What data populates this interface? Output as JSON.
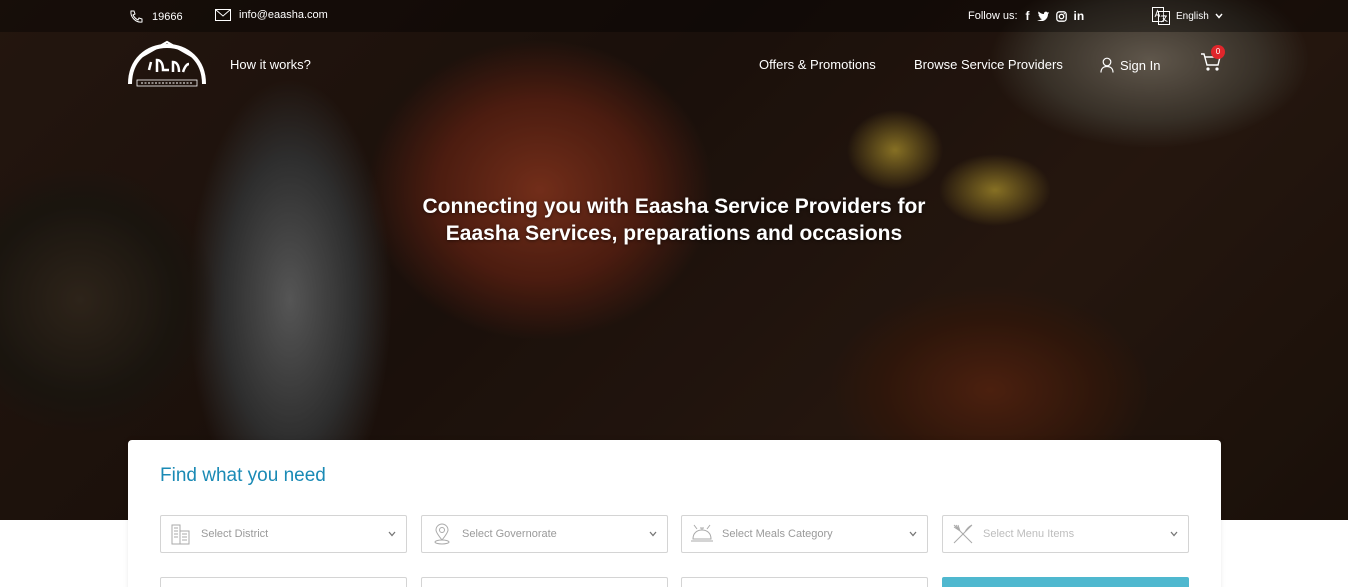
{
  "topbar": {
    "phone": "19666",
    "email": "info@eaasha.com",
    "follow_label": "Follow us:",
    "social_icons": [
      "facebook-icon",
      "twitter-icon",
      "instagram-icon",
      "linkedin-icon"
    ],
    "social_glyphs": {
      "facebook": "f",
      "linkedin": "in"
    },
    "language": "English"
  },
  "nav": {
    "how_it_works": "How it works?",
    "offers": "Offers & Promotions",
    "browse": "Browse Service Providers",
    "sign_in": "Sign In",
    "cart_count": "0"
  },
  "hero": {
    "headline_line1": "Connecting you with Eaasha Service Providers for",
    "headline_line2": "Eaasha Services, preparations and occasions"
  },
  "search": {
    "title": "Find what you need",
    "fields": [
      {
        "placeholder": "Select District",
        "icon": "building-icon"
      },
      {
        "placeholder": "Select Governorate",
        "icon": "map-pin-icon"
      },
      {
        "placeholder": "Select Meals Category",
        "icon": "food-tray-icon"
      },
      {
        "placeholder": "Select Menu Items",
        "icon": "fork-knife-icon"
      }
    ]
  },
  "colors": {
    "accent": "#1a8ab5",
    "button": "#4fb8cf",
    "badge": "#e0262b"
  }
}
